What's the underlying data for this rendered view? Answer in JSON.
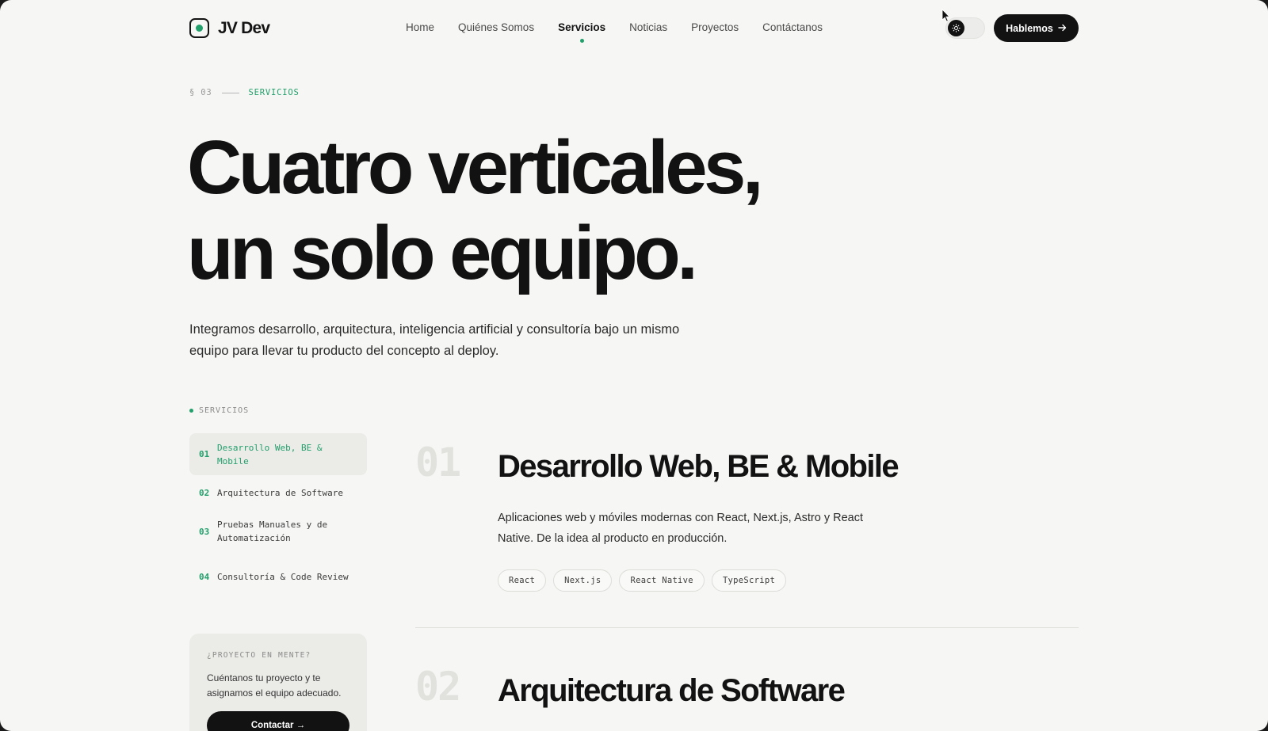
{
  "colors": {
    "accent": "#22a06b",
    "ink": "#121212",
    "background": "#f6f6f4"
  },
  "brand": {
    "name": "JV Dev",
    "icon": "logo-square-icon"
  },
  "nav": {
    "items": [
      {
        "label": "Home",
        "active": false
      },
      {
        "label": "Quiénes Somos",
        "active": false
      },
      {
        "label": "Servicios",
        "active": true
      },
      {
        "label": "Noticias",
        "active": false
      },
      {
        "label": "Proyectos",
        "active": false
      },
      {
        "label": "Contáctanos",
        "active": false
      }
    ],
    "theme_toggle_icon": "sun-icon",
    "cta_label": "Hablemos",
    "cta_icon": "arrow-right-icon"
  },
  "hero": {
    "section_number": "§ 03",
    "section_tag": "SERVICIOS",
    "title_line1": "Cuatro verticales,",
    "title_line2": "un solo equipo.",
    "subtitle": "Integramos desarrollo, arquitectura, inteligencia artificial y consultoría bajo un mismo equipo para llevar tu producto del concepto al deploy."
  },
  "sidebar": {
    "heading": "SERVICIOS",
    "items": [
      {
        "num": "01",
        "label": "Desarrollo Web, BE & Mobile",
        "active": true
      },
      {
        "num": "02",
        "label": "Arquitectura de Software",
        "active": false
      },
      {
        "num": "03",
        "label": "Pruebas Manuales y de Automatización",
        "active": false
      },
      {
        "num": "04",
        "label": "Consultoría & Code Review",
        "active": false
      }
    ],
    "card": {
      "eyebrow": "¿PROYECTO EN MENTE?",
      "text": "Cuéntanos tu proyecto y te asignamos el equipo adecuado.",
      "button_label": "Contactar →"
    }
  },
  "services": [
    {
      "num": "01",
      "title": "Desarrollo Web, BE & Mobile",
      "description": "Aplicaciones web y móviles modernas con React, Next.js, Astro y React Native. De la idea al producto en producción.",
      "tags": [
        "React",
        "Next.js",
        "React Native",
        "TypeScript"
      ]
    },
    {
      "num": "02",
      "title": "Arquitectura de Software"
    }
  ]
}
